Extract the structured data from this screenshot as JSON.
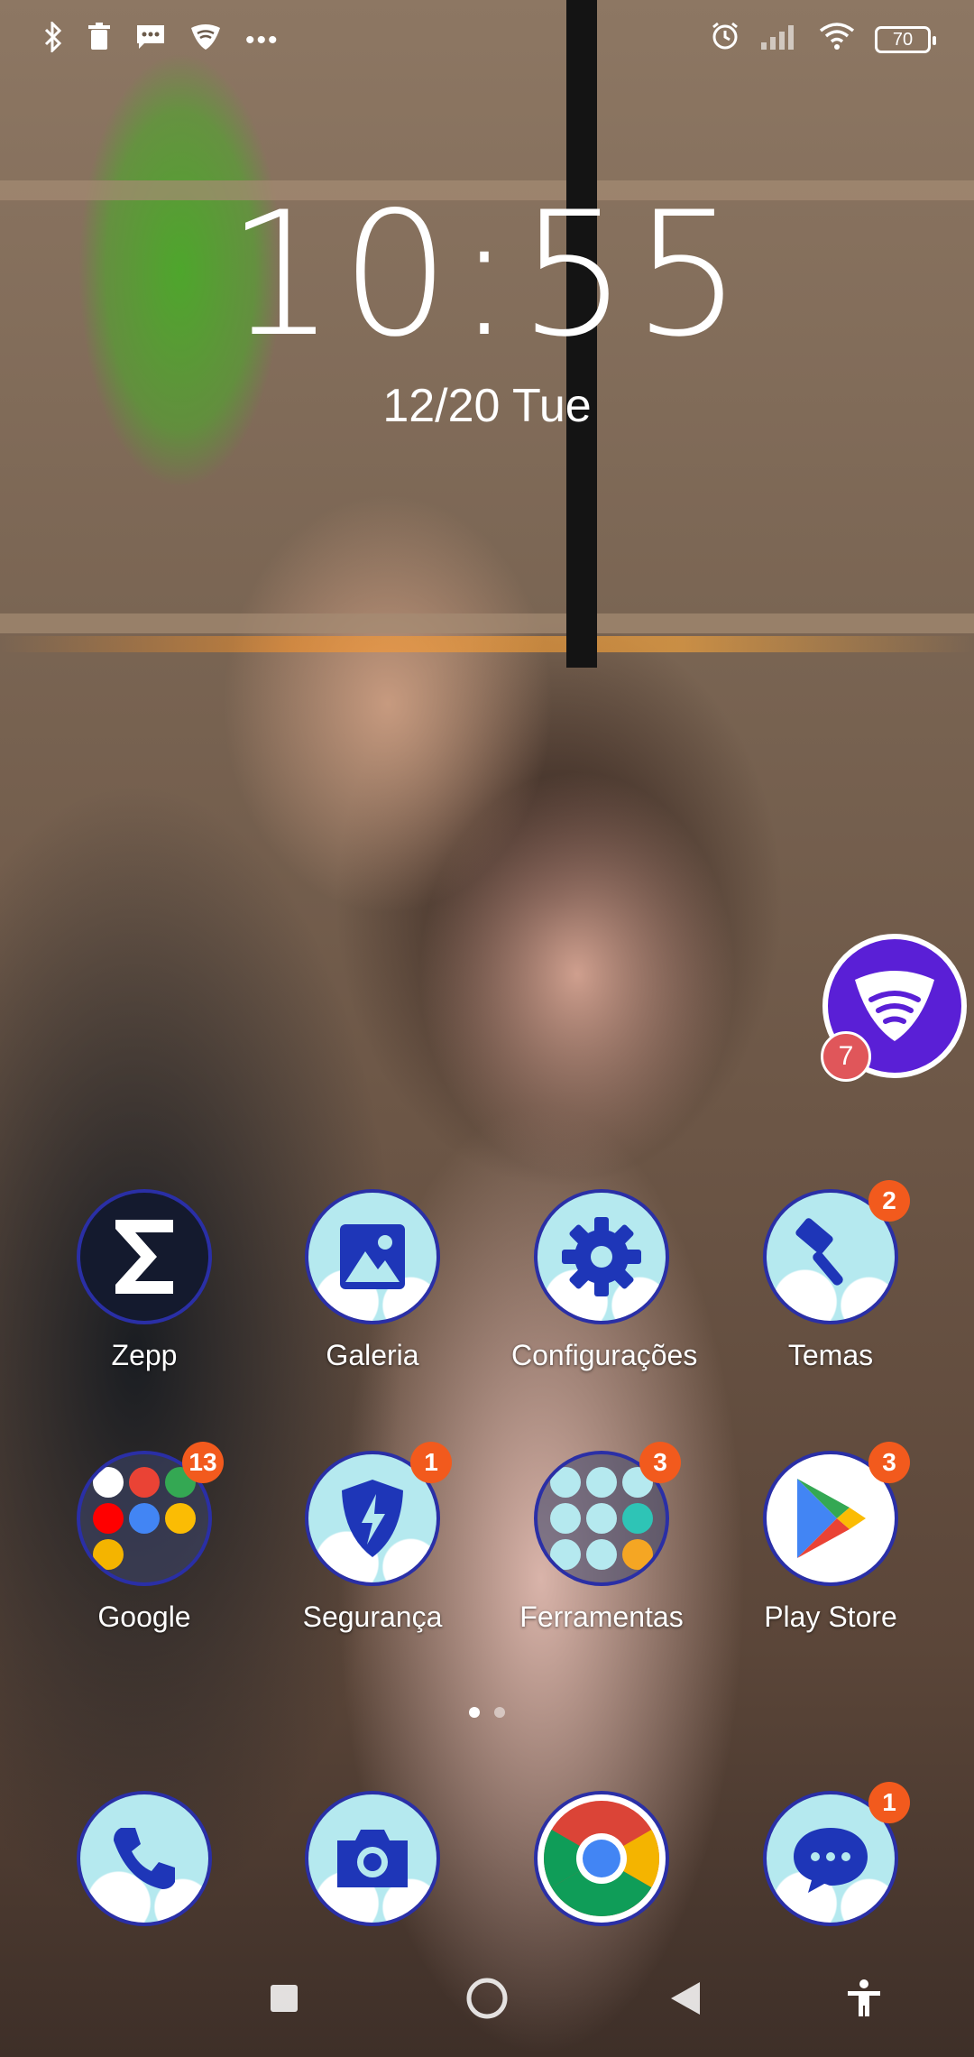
{
  "status_bar": {
    "left_icons": [
      "bluetooth-icon",
      "trash-icon",
      "message-icon",
      "shield-wifi-icon",
      "more-icon"
    ],
    "right_icons": [
      "alarm-icon",
      "signal-icon",
      "wifi-icon"
    ],
    "battery": "70"
  },
  "lock": {
    "time": "10:55",
    "date": "12/20",
    "weekday": "Tue"
  },
  "floating": {
    "icon": "shield-wifi-icon",
    "badge": "7",
    "color": "#5a1fd6"
  },
  "apps_row1": [
    {
      "label": "Zepp",
      "badge": ""
    },
    {
      "label": "Galeria",
      "badge": ""
    },
    {
      "label": "Configurações",
      "badge": ""
    },
    {
      "label": "Temas",
      "badge": "2"
    }
  ],
  "apps_row2": [
    {
      "label": "Google",
      "badge": "13"
    },
    {
      "label": "Segurança",
      "badge": "1"
    },
    {
      "label": "Ferramentas",
      "badge": "3"
    },
    {
      "label": "Play Store",
      "badge": "3"
    }
  ],
  "dock": [
    {
      "name": "phone",
      "badge": ""
    },
    {
      "name": "camera",
      "badge": ""
    },
    {
      "name": "chrome",
      "badge": ""
    },
    {
      "name": "messages",
      "badge": "1"
    }
  ],
  "colors": {
    "badge": "#f25a1d",
    "icon_border": "#2a2fa6",
    "icon_bg": "#b5e9ef"
  }
}
